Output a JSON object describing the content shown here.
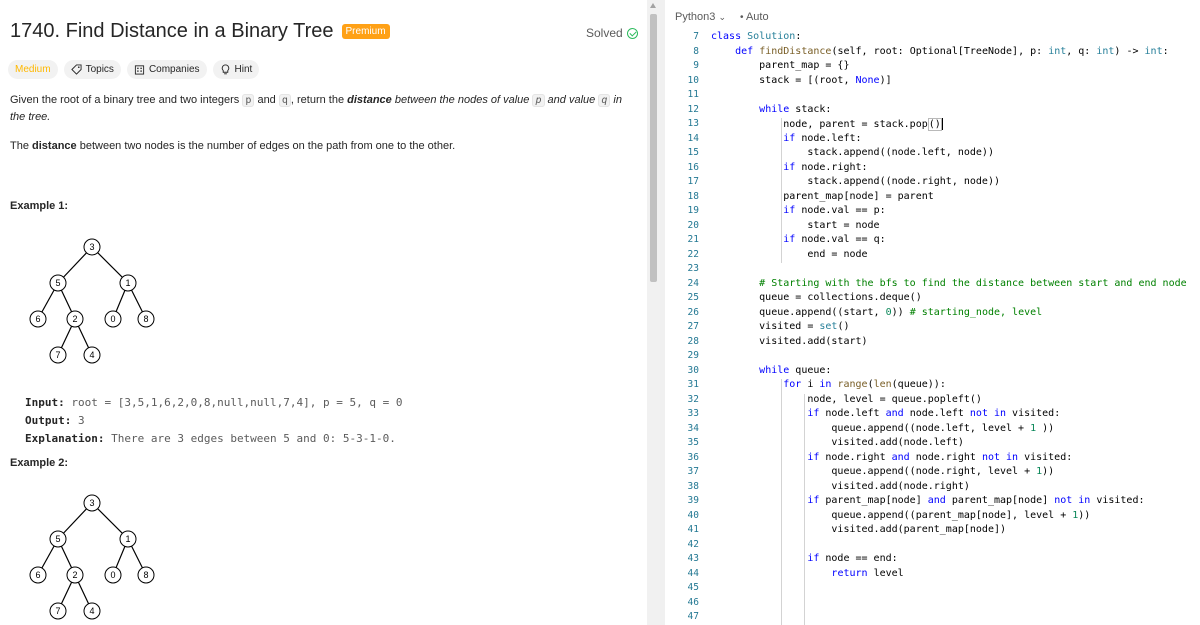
{
  "problem": {
    "title": "1740. Find Distance in a Binary Tree",
    "premium_label": "Premium",
    "solved_label": "Solved",
    "difficulty": "Medium",
    "tags": [
      "Topics",
      "Companies",
      "Hint"
    ],
    "desc1_a": "Given the root of a binary tree and two integers ",
    "desc1_p": "p",
    "desc1_and": " and ",
    "desc1_q": "q",
    "desc1_b": ", return the ",
    "desc1_dist": "distance",
    "desc1_c": " between the nodes of value ",
    "desc1_p2": "p",
    "desc1_d": " and value ",
    "desc1_q2": "q",
    "desc1_e": " in the tree.",
    "desc2_a": "The ",
    "desc2_dist": "distance",
    "desc2_b": " between two nodes is the number of edges on the path from one to the other.",
    "example1_head": "Example 1:",
    "example2_head": "Example 2:",
    "input_label": "Input:",
    "input_value": "root = [3,5,1,6,2,0,8,null,null,7,4], p = 5, q = 0",
    "output_label": "Output:",
    "output_value": "3",
    "explanation_label": "Explanation:",
    "explanation_value": "There are 3 edges between 5 and 0: 5-3-1-0.",
    "tree_nodes": [
      "3",
      "5",
      "1",
      "6",
      "2",
      "0",
      "8",
      "7",
      "4"
    ]
  },
  "editor": {
    "language": "Python3",
    "mode": "Auto",
    "lines": [
      {
        "n": "7",
        "html": "<span class=\"kw\">class</span> <span class=\"cls\">Solution</span>:"
      },
      {
        "n": "8",
        "html": "    <span class=\"kw\">def</span> <span class=\"fn\">findDistance</span>(self, root: Optional[TreeNode], p: <span class=\"cls\">int</span>, q: <span class=\"cls\">int</span>) -> <span class=\"cls\">int</span>:"
      },
      {
        "n": "9",
        "html": "        parent_map = {}"
      },
      {
        "n": "10",
        "html": "        stack = [(root, <span class=\"kw\">None</span>)]"
      },
      {
        "n": "11",
        "html": ""
      },
      {
        "n": "12",
        "html": "        <span class=\"kw\">while</span> stack:"
      },
      {
        "n": "13",
        "html": "            node, parent = stack.pop<span class=\"paren-box\">()</span><span class=\"cursor\"></span>"
      },
      {
        "n": "14",
        "html": "            <span class=\"kw\">if</span> node.left:"
      },
      {
        "n": "15",
        "html": "                stack.append((node.left, node))"
      },
      {
        "n": "16",
        "html": "            <span class=\"kw\">if</span> node.right:"
      },
      {
        "n": "17",
        "html": "                stack.append((node.right, node))"
      },
      {
        "n": "18",
        "html": "            parent_map[node] = parent"
      },
      {
        "n": "19",
        "html": "            <span class=\"kw\">if</span> node.val == p:"
      },
      {
        "n": "20",
        "html": "                start = node"
      },
      {
        "n": "21",
        "html": "            <span class=\"kw\">if</span> node.val == q:"
      },
      {
        "n": "22",
        "html": "                end = node"
      },
      {
        "n": "23",
        "html": ""
      },
      {
        "n": "24",
        "html": "        <span class=\"cmt\"># Starting with the bfs to find the distance between start and end node</span>"
      },
      {
        "n": "25",
        "html": "        queue = collections.deque()"
      },
      {
        "n": "26",
        "html": "        queue.append((start, <span class=\"num\">0</span>)) <span class=\"cmt\"># starting_node, level</span>"
      },
      {
        "n": "27",
        "html": "        visited = <span class=\"cls\">set</span>()"
      },
      {
        "n": "28",
        "html": "        visited.add(start)"
      },
      {
        "n": "29",
        "html": ""
      },
      {
        "n": "30",
        "html": "        <span class=\"kw\">while</span> queue:"
      },
      {
        "n": "31",
        "html": "            <span class=\"kw\">for</span> i <span class=\"kw\">in</span> <span class=\"fn\">range</span>(<span class=\"fn\">len</span>(queue)):"
      },
      {
        "n": "32",
        "html": "                node, level = queue.popleft()"
      },
      {
        "n": "33",
        "html": "                <span class=\"kw\">if</span> node.left <span class=\"kw\">and</span> node.left <span class=\"kw\">not in</span> visited:"
      },
      {
        "n": "34",
        "html": "                    queue.append((node.left, level + <span class=\"num\">1</span> ))"
      },
      {
        "n": "35",
        "html": "                    visited.add(node.left)"
      },
      {
        "n": "36",
        "html": "                <span class=\"kw\">if</span> node.right <span class=\"kw\">and</span> node.right <span class=\"kw\">not in</span> visited:"
      },
      {
        "n": "37",
        "html": "                    queue.append((node.right, level + <span class=\"num\">1</span>))"
      },
      {
        "n": "38",
        "html": "                    visited.add(node.right)"
      },
      {
        "n": "39",
        "html": "                <span class=\"kw\">if</span> parent_map[node] <span class=\"kw\">and</span> parent_map[node] <span class=\"kw\">not in</span> visited:"
      },
      {
        "n": "40",
        "html": "                    queue.append((parent_map[node], level + <span class=\"num\">1</span>))"
      },
      {
        "n": "41",
        "html": "                    visited.add(parent_map[node])"
      },
      {
        "n": "42",
        "html": ""
      },
      {
        "n": "43",
        "html": "                <span class=\"kw\">if</span> node == end:"
      },
      {
        "n": "44",
        "html": "                    <span class=\"kw\">return</span> level"
      },
      {
        "n": "45",
        "html": ""
      },
      {
        "n": "46",
        "html": ""
      },
      {
        "n": "47",
        "html": ""
      }
    ]
  },
  "colors": {
    "premium": "#ffa116",
    "medium": "#ffb800",
    "solved": "#2cbb5d",
    "keyword": "#0000ff"
  }
}
